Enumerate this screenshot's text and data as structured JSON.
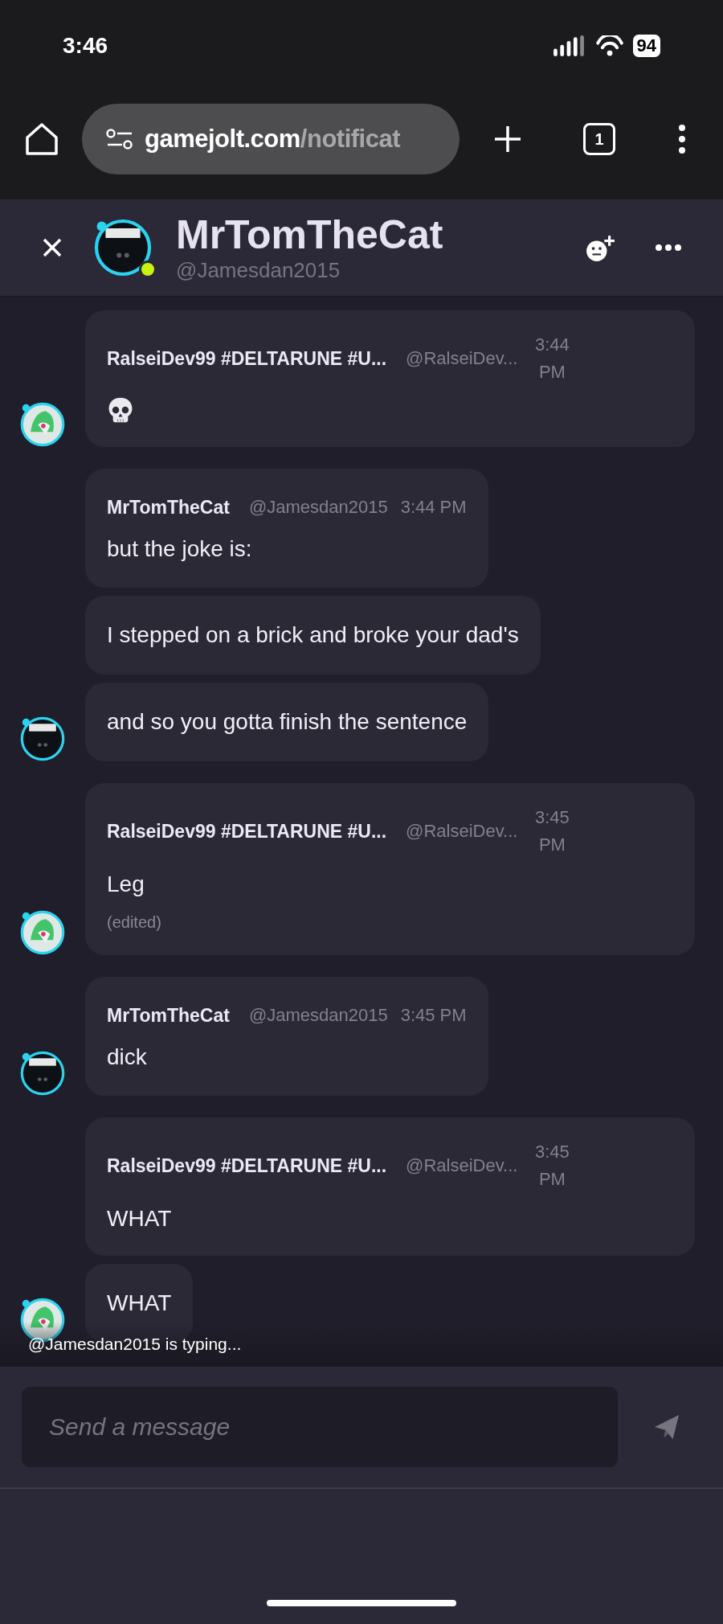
{
  "status_bar": {
    "time": "3:46",
    "battery": "94"
  },
  "browser": {
    "url_host": "gamejolt.com",
    "url_path": "/notificat",
    "tab_count": "1"
  },
  "header": {
    "name": "MrTomTheCat",
    "handle": "@Jamesdan2015",
    "online": true
  },
  "groups": [
    {
      "kind": "stacked",
      "author": "RalseiDev99 #DELTARUNE #U...",
      "handle": "@RalseiDev...",
      "time": "3:44 PM",
      "messages": [
        {
          "kind": "icon",
          "edited": false
        }
      ]
    },
    {
      "kind": "inline",
      "author": "MrTomTheCat",
      "handle": "@Jamesdan2015",
      "time": "3:44 PM",
      "messages": [
        {
          "kind": "text",
          "text": "but the joke is:",
          "edited": false
        },
        {
          "kind": "text",
          "text": "I stepped on a brick and broke your dad's",
          "edited": false
        },
        {
          "kind": "text",
          "text": "and so you gotta finish the sentence",
          "edited": false
        }
      ]
    },
    {
      "kind": "stacked",
      "author": "RalseiDev99 #DELTARUNE #U...",
      "handle": "@RalseiDev...",
      "time": "3:45 PM",
      "messages": [
        {
          "kind": "text",
          "text": "Leg",
          "edited": true,
          "edited_label": "(edited)"
        }
      ]
    },
    {
      "kind": "inline",
      "author": "MrTomTheCat",
      "handle": "@Jamesdan2015",
      "time": "3:45 PM",
      "messages": [
        {
          "kind": "text",
          "text": "dick",
          "edited": false
        }
      ]
    },
    {
      "kind": "stacked",
      "author": "RalseiDev99 #DELTARUNE #U...",
      "handle": "@RalseiDev...",
      "time": "3:45 PM",
      "messages": [
        {
          "kind": "text",
          "text": "WHAT",
          "edited": false
        },
        {
          "kind": "text",
          "text": "WHAT",
          "edited": false
        }
      ]
    }
  ],
  "typing": "@Jamesdan2015 is typing...",
  "composer": {
    "placeholder": "Send a message"
  }
}
